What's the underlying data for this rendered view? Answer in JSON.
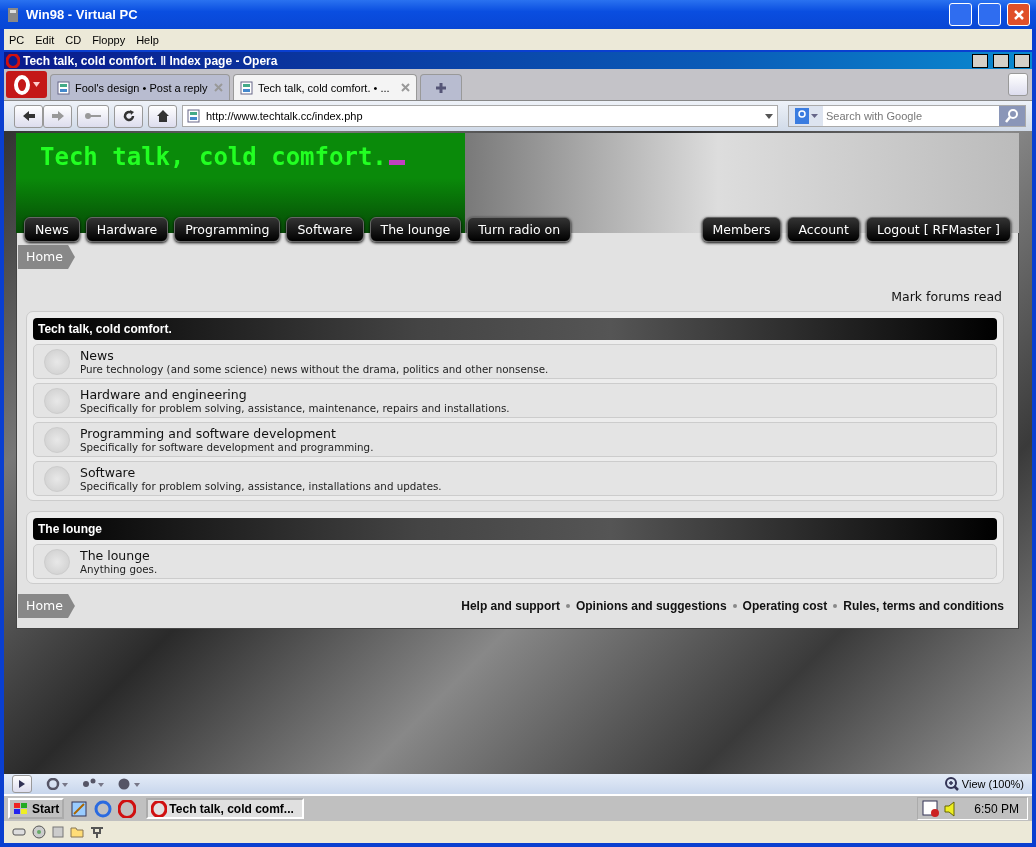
{
  "window": {
    "title": "Win98 - Virtual PC",
    "menu": [
      "PC",
      "Edit",
      "CD",
      "Floppy",
      "Help"
    ]
  },
  "browser": {
    "title": "Tech talk, cold comfort. ‖ Index page - Opera",
    "tabs": [
      {
        "label": "Fool's design • Post a reply",
        "selected": false
      },
      {
        "label": "Tech talk, cold comfort. • ...",
        "selected": true
      }
    ],
    "address": "http://www.techtalk.cc/index.php",
    "search_placeholder": "Search with Google"
  },
  "site": {
    "title": "Tech talk, cold comfort.",
    "nav_left": [
      "News",
      "Hardware",
      "Programming",
      "Software",
      "The lounge",
      "Turn radio on"
    ],
    "nav_right": [
      "Members",
      "Account",
      "Logout [ RFMaster ]"
    ],
    "breadcrumb": "Home",
    "mark_read": "Mark forums read",
    "categories": [
      {
        "title": "Tech talk, cold comfort.",
        "forums": [
          {
            "name": "News",
            "description": "Pure technology (and some science) news without the drama, politics and other nonsense."
          },
          {
            "name": "Hardware and engineering",
            "description": "Specifically for problem solving, assistance, maintenance, repairs and installations."
          },
          {
            "name": "Programming and software development",
            "description": "Specifically for software development and programming."
          },
          {
            "name": "Software",
            "description": "Specifically for problem solving, assistance, installations and updates."
          }
        ]
      },
      {
        "title": "The lounge",
        "forums": [
          {
            "name": "The lounge",
            "description": "Anything goes."
          }
        ]
      }
    ],
    "footer_breadcrumb": "Home",
    "footer_links": [
      "Help and support",
      "Opinions and suggestions",
      "Operating cost",
      "Rules, terms and conditions"
    ]
  },
  "status_bar": {
    "zoom": "View (100%)"
  },
  "taskbar": {
    "start": "Start",
    "task": "Tech talk, cold comf...",
    "clock": "6:50 PM"
  }
}
